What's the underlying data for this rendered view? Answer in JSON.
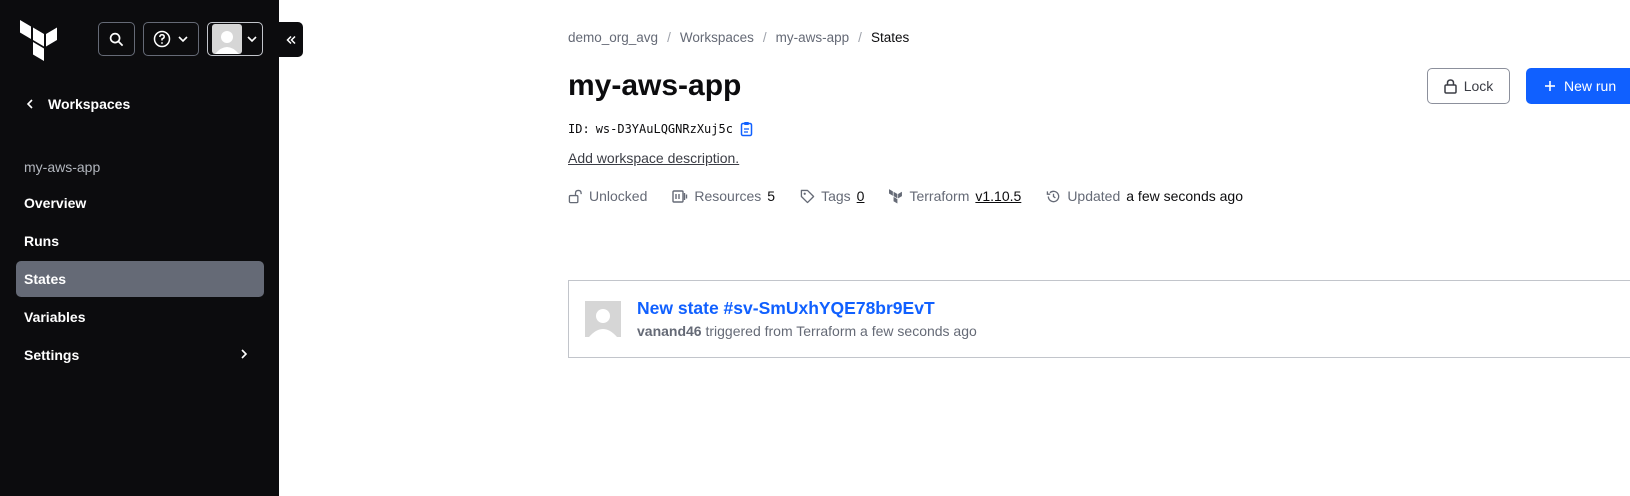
{
  "sidebar": {
    "back_label": "Workspaces",
    "section_label": "my-aws-app",
    "items": [
      {
        "label": "Overview"
      },
      {
        "label": "Runs"
      },
      {
        "label": "States"
      },
      {
        "label": "Variables"
      },
      {
        "label": "Settings"
      }
    ],
    "active_item": "States"
  },
  "breadcrumb": {
    "items": [
      "demo_org_avg",
      "Workspaces",
      "my-aws-app",
      "States"
    ],
    "separator": "/"
  },
  "header": {
    "title": "my-aws-app",
    "id_label": "ID:",
    "id_value": "ws-D3YAuLQGNRzXuj5c",
    "add_description": "Add workspace description.",
    "lock_label": "Lock",
    "new_run_label": "New run"
  },
  "meta": {
    "lock_status": "Unlocked",
    "resources_label": "Resources",
    "resources_count": "5",
    "tags_label": "Tags",
    "tags_count": "0",
    "terraform_label": "Terraform",
    "terraform_version": "v1.10.5",
    "updated_label": "Updated",
    "updated_value": "a few seconds ago"
  },
  "states": [
    {
      "title": "New state #sv-SmUxhYQE78br9EvT",
      "user": "vanand46",
      "action": " triggered from Terraform a few seconds ago"
    }
  ],
  "icons": [
    "terraform-logo",
    "search-icon",
    "help-icon",
    "chevron-down-icon",
    "avatar",
    "collapse-icon",
    "chevron-left-icon",
    "chevron-right-icon",
    "copy-icon",
    "unlock-icon",
    "resources-icon",
    "tag-icon",
    "terraform-icon",
    "history-icon",
    "lock-icon",
    "plus-icon"
  ],
  "colors": {
    "sidebar_bg": "#0c0c0e",
    "active_item": "#656a76",
    "accent": "#1060ff"
  }
}
